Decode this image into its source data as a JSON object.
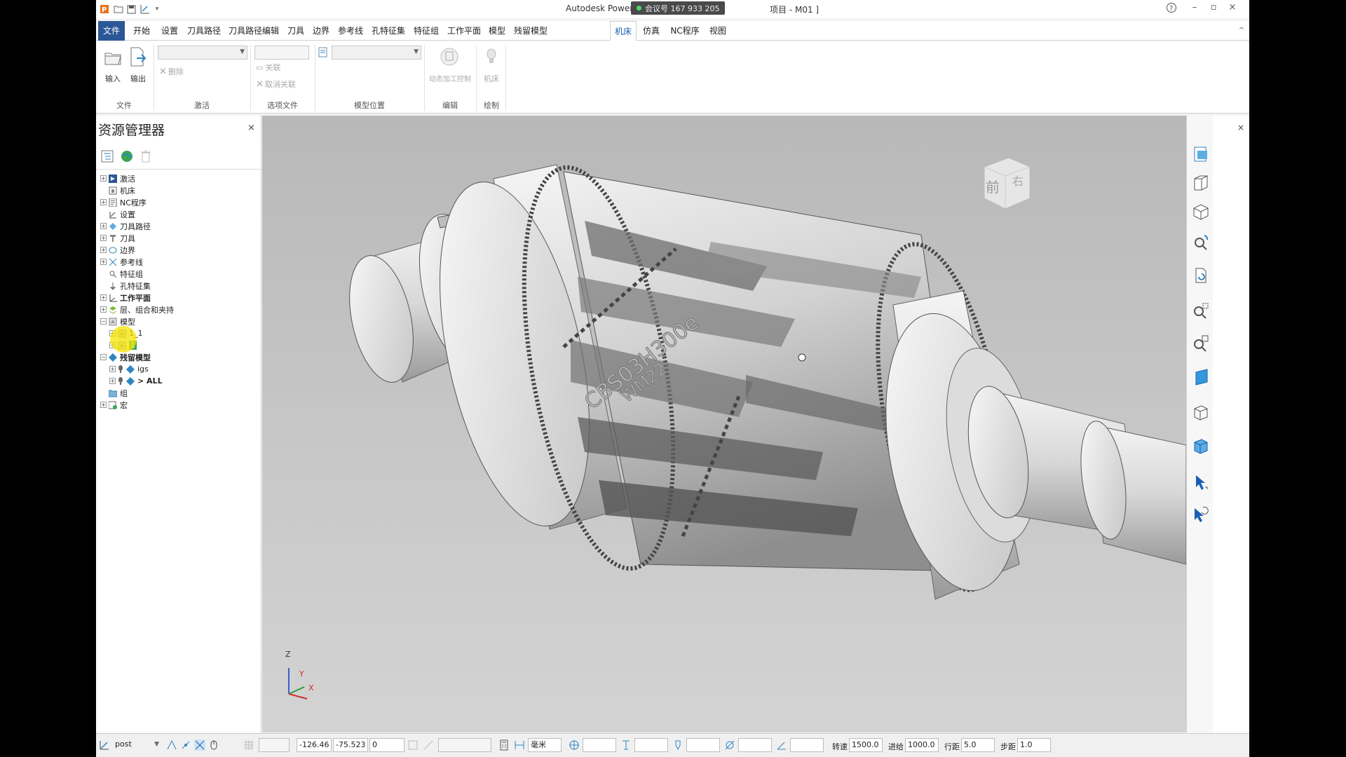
{
  "titlebar": {
    "app_title": "Autodesk PowerMill",
    "title_suffix": "项目 - M01 ]",
    "meeting_badge": "会议号 167 933 205",
    "help": "?",
    "minimize": "–",
    "restore": "▫",
    "close": "×"
  },
  "menu": {
    "tabs": [
      "文件",
      "开始",
      "设置",
      "刀具路径",
      "刀具路径编辑",
      "刀具",
      "边界",
      "参考线",
      "孔特征集",
      "特征组",
      "工作平面",
      "模型",
      "残留模型",
      "机床",
      "仿真",
      "NC程序",
      "视图"
    ],
    "active_tab": "机床",
    "collapse": "^"
  },
  "ribbon": {
    "file_group": {
      "label": "文件",
      "import": "输入",
      "export": "输出"
    },
    "activate_group": {
      "label": "激活",
      "delete": "删除"
    },
    "option_group": {
      "label": "选项文件",
      "link": "关联",
      "unlink": "取消关联"
    },
    "position_group": {
      "label": "模型位置"
    },
    "edit_group": {
      "label": "编辑",
      "dynamic": "动态加工控制"
    },
    "draw_group": {
      "label": "绘制",
      "machine": "机床"
    }
  },
  "explorer": {
    "title": "资源管理器",
    "close": "×",
    "tree": [
      {
        "label": "激活",
        "bold": false
      },
      {
        "label": "机床",
        "bold": false
      },
      {
        "label": "NC程序",
        "bold": false
      },
      {
        "label": "设置",
        "bold": false
      },
      {
        "label": "刀具路径",
        "bold": false
      },
      {
        "label": "刀具",
        "bold": false
      },
      {
        "label": "边界",
        "bold": false
      },
      {
        "label": "参考线",
        "bold": false
      },
      {
        "label": "特征组",
        "bold": false
      },
      {
        "label": "孔特征集",
        "bold": false
      },
      {
        "label": "工作平面",
        "bold": true
      },
      {
        "label": "层、组合和夹持",
        "bold": false
      },
      {
        "label": "模型",
        "bold": false
      },
      {
        "label": "1_1",
        "bold": false
      },
      {
        "label": "1",
        "bold": false
      },
      {
        "label": "残留模型",
        "bold": true
      },
      {
        "label": "igs",
        "bold": false
      },
      {
        "label": "> ALL",
        "bold": true
      },
      {
        "label": "组",
        "bold": false
      },
      {
        "label": "宏",
        "bold": false
      }
    ]
  },
  "viewcube": {
    "front": "前",
    "right": "右"
  },
  "axes": {
    "z": "Z",
    "y": "Y",
    "x": "X"
  },
  "part_text": {
    "line1": "CBS03H300e",
    "line2": "WM22"
  },
  "statusbar": {
    "workplane": "post",
    "coord_x": "-126.46",
    "coord_y": "-75.523",
    "coord_z": "0",
    "unit": "毫米",
    "speed_label": "转速",
    "speed": "1500.0",
    "feed_label": "进给",
    "feed": "1000.0",
    "stepdown_label": "行距",
    "stepdown": "5.0",
    "stepover_label": "步距",
    "stepover": "1.0"
  },
  "colors": {
    "file_tab": "#2b5797",
    "accent": "#1a5fb4",
    "highlight": "#f5e400",
    "icon_blue": "#2e86c1"
  }
}
